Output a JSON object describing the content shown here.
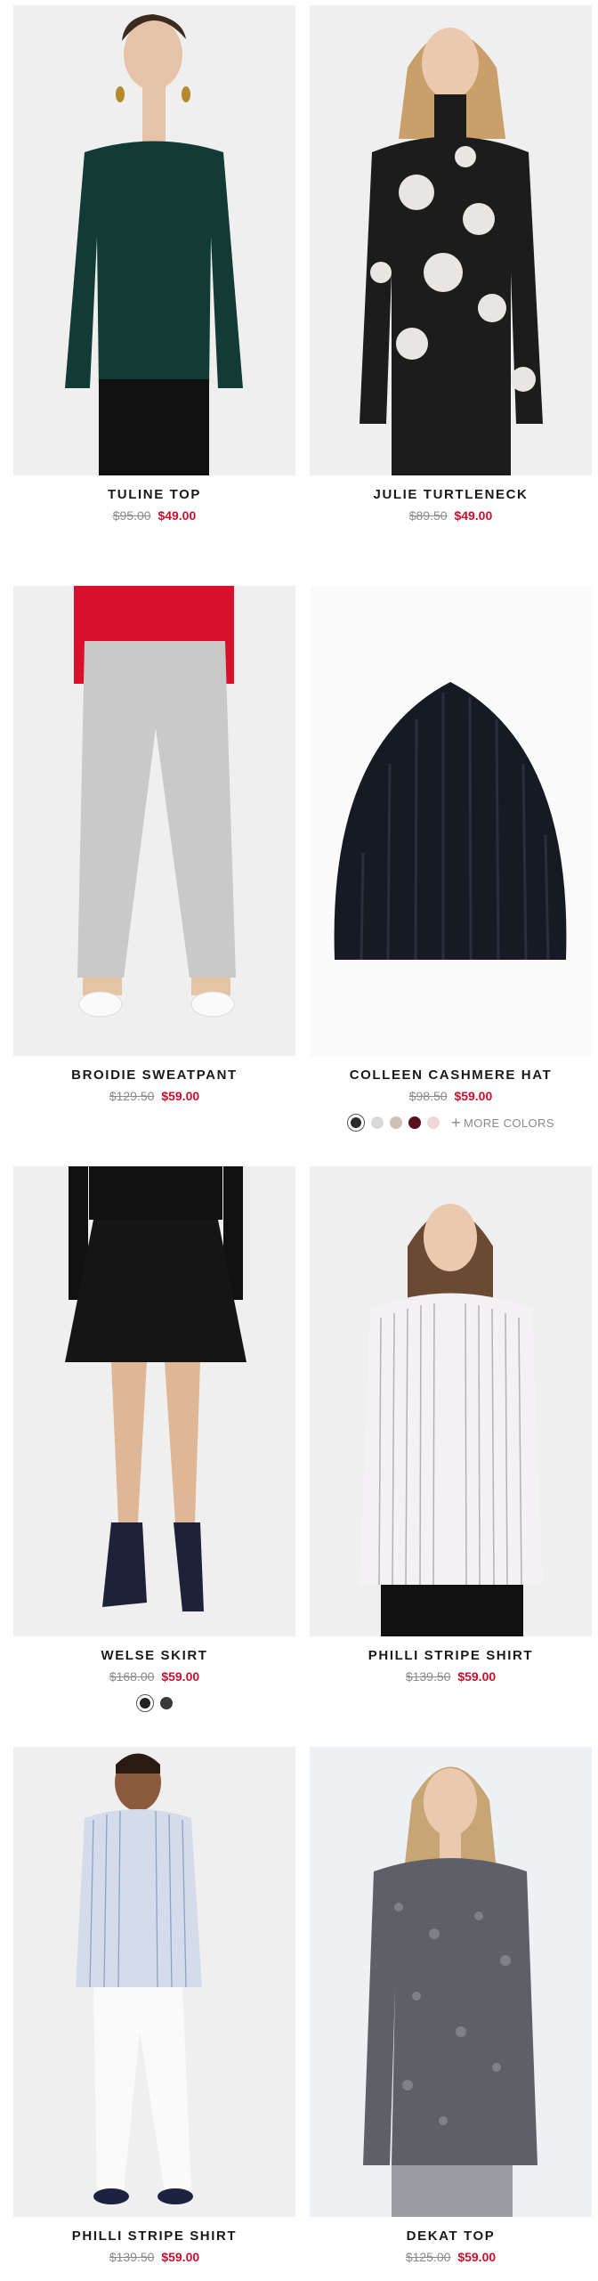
{
  "products": [
    {
      "name": "TULINE TOP",
      "old_price": "$95.00",
      "sale_price": "$49.00",
      "swatches": []
    },
    {
      "name": "JULIE TURTLENECK",
      "old_price": "$89.50",
      "sale_price": "$49.00",
      "swatches": []
    },
    {
      "name": "BROIDIE SWEATPANT",
      "old_price": "$129.50",
      "sale_price": "$59.00",
      "swatches": []
    },
    {
      "name": "COLLEEN CASHMERE HAT",
      "old_price": "$98.50",
      "sale_price": "$59.00",
      "swatches": [
        "#2b2b2b",
        "#d9d9d9",
        "#cfc2b8",
        "#5a0f1e",
        "#f1d6d6"
      ],
      "more_label": "MORE COLORS"
    },
    {
      "name": "WELSE SKIRT",
      "old_price": "$168.00",
      "sale_price": "$59.00",
      "swatches": [
        "#222222",
        "#3a3a3a"
      ]
    },
    {
      "name": "PHILLI STRIPE SHIRT",
      "old_price": "$139.50",
      "sale_price": "$59.00",
      "swatches": []
    },
    {
      "name": "PHILLI STRIPE SHIRT",
      "old_price": "$139.50",
      "sale_price": "$59.00",
      "swatches": []
    },
    {
      "name": "DEKAT TOP",
      "old_price": "$125.00",
      "sale_price": "$59.00",
      "swatches": []
    }
  ],
  "colors": {
    "sale": "#c8102e",
    "strike": "#8a8a8a",
    "title": "#1a1a1a",
    "image_bg": "#f1f1f1"
  }
}
